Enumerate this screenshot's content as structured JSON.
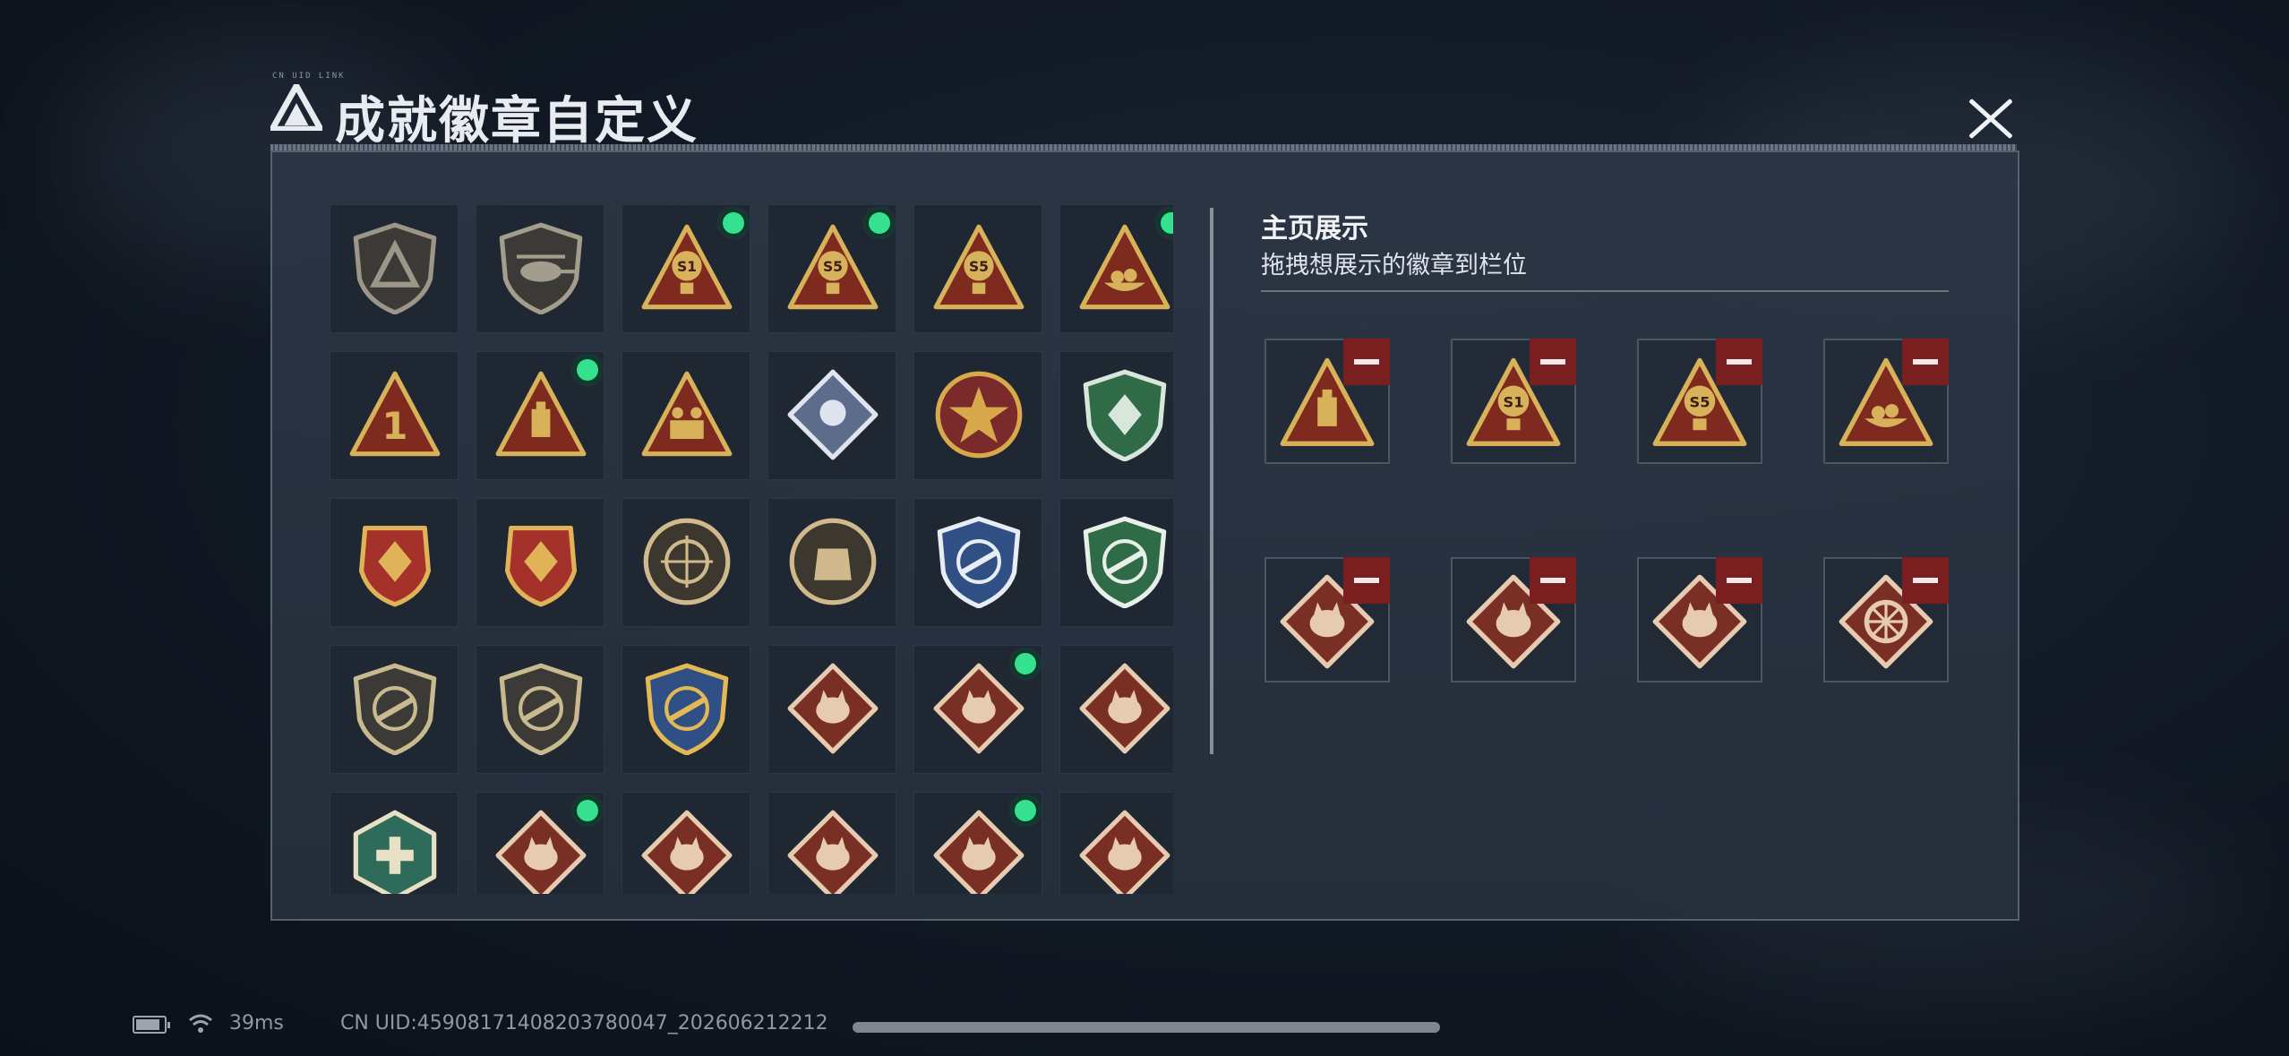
{
  "dialog": {
    "title": "成就徽章自定义",
    "deco_text": "CN UID LINK"
  },
  "inventory": {
    "badges": [
      {
        "icon": "triangle-emblem-shield-icon",
        "shape": "shield",
        "bg": "#3b3a36",
        "fg": "#9c9688",
        "sym": "logo",
        "equipped": false
      },
      {
        "icon": "helicopter-shield-icon",
        "shape": "shield",
        "bg": "#3b3a36",
        "fg": "#a39d8e",
        "sym": "heli",
        "equipped": false
      },
      {
        "icon": "balloon-s1-triangle-icon",
        "shape": "triangle",
        "bg": "#7e2a1f",
        "fg": "#d8b25a",
        "sym": "S1",
        "equipped": true
      },
      {
        "icon": "sack-s5-triangle-icon",
        "shape": "triangle",
        "bg": "#7e2a1f",
        "fg": "#d8b25a",
        "sym": "S5",
        "equipped": true
      },
      {
        "icon": "winged-s5-triangle-icon",
        "shape": "triangle",
        "bg": "#7e2a1f",
        "fg": "#d8b25a",
        "sym": "S5",
        "equipped": false
      },
      {
        "icon": "eggs-nest-triangle-icon",
        "shape": "triangle",
        "bg": "#7e2a1f",
        "fg": "#d8b25a",
        "sym": "nest",
        "equipped": true
      },
      {
        "icon": "number-one-triangle-icon",
        "shape": "triangle",
        "bg": "#7e2a1f",
        "fg": "#d8b25a",
        "sym": "1",
        "equipped": false
      },
      {
        "icon": "usb-drive-triangle-icon",
        "shape": "triangle",
        "bg": "#7e2a1f",
        "fg": "#d8b25a",
        "sym": "usb",
        "equipped": true
      },
      {
        "icon": "soldiers-triangle-icon",
        "shape": "triangle",
        "bg": "#7e2a1f",
        "fg": "#d8b25a",
        "sym": "troop",
        "equipped": false
      },
      {
        "icon": "rose-diamond-icon",
        "shape": "diamond",
        "bg": "#5d6c8a",
        "fg": "#dfe4ee",
        "sym": "rose",
        "equipped": false
      },
      {
        "icon": "star-medal-icon",
        "shape": "round",
        "bg": "#7a2a2a",
        "fg": "#d7a94a",
        "sym": "star",
        "equipped": false
      },
      {
        "icon": "green-crest-shield-icon",
        "shape": "shield",
        "bg": "#2f6b47",
        "fg": "#d8e6dc",
        "sym": "crest",
        "equipped": false
      },
      {
        "icon": "red-winged-crest-icon",
        "shape": "crest",
        "bg": "#a4312a",
        "fg": "#e0b358",
        "sym": "crest",
        "equipped": false
      },
      {
        "icon": "red-gem-crest-icon",
        "shape": "crest",
        "bg": "#a4312a",
        "fg": "#e0b358",
        "sym": "gem",
        "equipped": false
      },
      {
        "icon": "gunsight-man-round-icon",
        "shape": "round",
        "bg": "#3c3830",
        "fg": "#d0b98c",
        "sym": "scope",
        "equipped": false
      },
      {
        "icon": "armor-round-icon",
        "shape": "round",
        "bg": "#3c3830",
        "fg": "#d0b98c",
        "sym": "armor",
        "equipped": false
      },
      {
        "icon": "blue-rifle-shield-icon",
        "shape": "shield",
        "bg": "#2f4f85",
        "fg": "#e7ecf5",
        "sym": "rifle",
        "equipped": false
      },
      {
        "icon": "green-rifle-shield-icon",
        "shape": "shield",
        "bg": "#2f6b47",
        "fg": "#e7efe9",
        "sym": "rifle",
        "equipped": false
      },
      {
        "icon": "rifle-shield-icon",
        "shape": "shield",
        "bg": "#3b3a36",
        "fg": "#c9b98e",
        "sym": "rifle",
        "equipped": false
      },
      {
        "icon": "sniper-shield-icon",
        "shape": "shield",
        "bg": "#3b3a36",
        "fg": "#c9b98e",
        "sym": "rifle",
        "equipped": false
      },
      {
        "icon": "blue-gold-rifle-shield-icon",
        "shape": "shield",
        "bg": "#2f4f85",
        "fg": "#e2b954",
        "sym": "rifle",
        "equipped": false
      },
      {
        "icon": "wolf-diamond-icon",
        "shape": "diamond",
        "bg": "#7a2f25",
        "fg": "#e7cbb0",
        "sym": "wolf",
        "equipped": false
      },
      {
        "icon": "wolf-diamond-icon",
        "shape": "diamond",
        "bg": "#7a2f25",
        "fg": "#e7cbb0",
        "sym": "wolf",
        "equipped": true
      },
      {
        "icon": "runner-diamond-icon",
        "shape": "diamond",
        "bg": "#7a2f25",
        "fg": "#e7cbb0",
        "sym": "run",
        "equipped": false
      },
      {
        "icon": "medic-hexagon-icon",
        "shape": "hex",
        "bg": "#2f6b5a",
        "fg": "#e7e0c4",
        "sym": "medic",
        "equipped": false
      },
      {
        "icon": "dragon-diamond-icon",
        "shape": "diamond",
        "bg": "#7a2f25",
        "fg": "#e7cbb0",
        "sym": "dragon",
        "equipped": true
      },
      {
        "icon": "dragon-diamond-icon",
        "shape": "diamond",
        "bg": "#7a2f25",
        "fg": "#e7cbb0",
        "sym": "dragon",
        "equipped": false
      },
      {
        "icon": "runner-diamond-icon",
        "shape": "diamond",
        "bg": "#7a2f25",
        "fg": "#e7cbb0",
        "sym": "run",
        "equipped": false
      },
      {
        "icon": "cobra-diamond-icon",
        "shape": "diamond",
        "bg": "#7a2f25",
        "fg": "#e7cbb0",
        "sym": "snake",
        "equipped": true
      },
      {
        "icon": "cobra-diamond-icon",
        "shape": "diamond",
        "bg": "#7a2f25",
        "fg": "#e7cbb0",
        "sym": "snake",
        "equipped": false
      }
    ]
  },
  "showcase": {
    "heading": "主页展示",
    "hint": "拖拽想展示的徽章到栏位",
    "slots": [
      {
        "icon": "usb-drive-triangle-icon",
        "shape": "triangle",
        "bg": "#7e2a1f",
        "fg": "#d8b25a",
        "sym": "usb"
      },
      {
        "icon": "balloon-s1-triangle-icon",
        "shape": "triangle",
        "bg": "#7e2a1f",
        "fg": "#d8b25a",
        "sym": "S1"
      },
      {
        "icon": "sack-s5-triangle-icon",
        "shape": "triangle",
        "bg": "#7e2a1f",
        "fg": "#d8b25a",
        "sym": "S5"
      },
      {
        "icon": "eggs-nest-triangle-icon",
        "shape": "triangle",
        "bg": "#7e2a1f",
        "fg": "#d8b25a",
        "sym": "nest"
      },
      {
        "icon": "wolf-diamond-icon",
        "shape": "diamond",
        "bg": "#7a2f25",
        "fg": "#e7cbb0",
        "sym": "wolf"
      },
      {
        "icon": "dragon-diamond-icon",
        "shape": "diamond",
        "bg": "#7a2f25",
        "fg": "#e7cbb0",
        "sym": "dragon"
      },
      {
        "icon": "cobra-diamond-icon",
        "shape": "diamond",
        "bg": "#7a2f25",
        "fg": "#e7cbb0",
        "sym": "snake"
      },
      {
        "icon": "wheel-diamond-icon",
        "shape": "diamond",
        "bg": "#7a2f25",
        "fg": "#e7cbb0",
        "sym": "wheel"
      }
    ]
  },
  "status_bar": {
    "ping": "39ms",
    "uid": "CN UID:4590817140820378004​7_20260621221​2"
  }
}
